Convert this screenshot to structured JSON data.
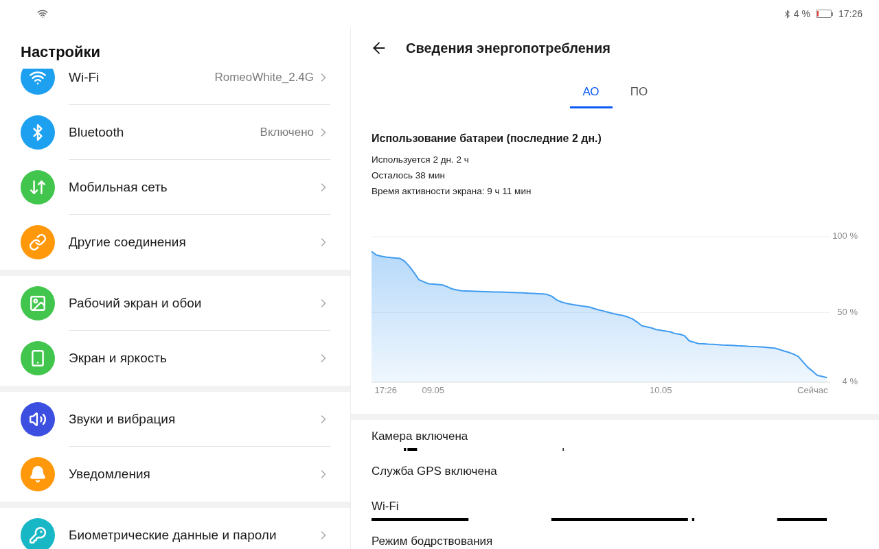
{
  "status_bar": {
    "battery": "4 %",
    "time": "17:26"
  },
  "settings": {
    "title": "Настройки",
    "sections": [
      {
        "items": [
          {
            "label": "Wi-Fi",
            "value": "RomeoWhite_2.4G",
            "color": "#1ea0f0"
          },
          {
            "label": "Bluetooth",
            "value": "Включено",
            "color": "#1ea0f0"
          },
          {
            "label": "Мобильная сеть",
            "color": "#41c54c"
          },
          {
            "label": "Другие соединения",
            "color": "#ff980a"
          }
        ]
      },
      {
        "items": [
          {
            "label": "Рабочий экран и обои",
            "color": "#41c54c"
          },
          {
            "label": "Экран и яркость",
            "color": "#41c54c"
          }
        ]
      },
      {
        "items": [
          {
            "label": "Звуки и вибрация",
            "color": "#3c4fe0"
          },
          {
            "label": "Уведомления",
            "color": "#ff980a"
          }
        ]
      },
      {
        "items": [
          {
            "label": "Биометрические данные и пароли",
            "color": "#17b7c5"
          }
        ]
      }
    ]
  },
  "power_details": {
    "title": "Сведения энергопотребления",
    "tabs": [
      {
        "label": "АО",
        "selected": true
      },
      {
        "label": "ПО",
        "selected": false
      }
    ],
    "usage": {
      "heading": "Использование батареи (последние 2 дн.)",
      "lines": [
        "Используется 2 дн. 2 ч",
        "Осталось 38 мин",
        "Время активности экрана: 9 ч 11 мин"
      ]
    },
    "chart_data": {
      "type": "area",
      "categories": [
        null,
        null,
        null,
        "17:26",
        null,
        null,
        null,
        null,
        null,
        null,
        null,
        null,
        null,
        "09.05",
        null,
        null,
        null,
        null,
        null,
        null,
        null,
        null,
        null,
        null,
        null,
        null,
        null,
        null,
        null,
        null,
        null,
        null,
        null,
        null,
        null,
        null,
        null,
        null,
        null,
        null,
        null,
        null,
        null,
        null,
        null,
        null,
        null,
        null,
        null,
        null,
        null,
        null,
        null,
        null,
        null,
        null,
        null,
        null,
        null,
        null,
        null,
        "10.05",
        null,
        null,
        null,
        null,
        null,
        null,
        null,
        null,
        null,
        null,
        null,
        null,
        null,
        null,
        null,
        null,
        null,
        null,
        null,
        null,
        null,
        null,
        null,
        null,
        null,
        null,
        null,
        null,
        null,
        null,
        null,
        "Сейчас",
        null,
        null,
        null
      ],
      "series": [
        {
          "color": "#3f9bf0",
          "values": [
            90.4,
            88.0,
            87.2,
            86.6,
            86.3,
            86.0,
            85.7,
            83.9,
            80.4,
            76.2,
            71.6,
            70.3,
            69.0,
            68.8,
            68.5,
            68.2,
            67.0,
            65.6,
            64.9,
            64.3,
            64.2,
            64.1,
            64.0,
            63.9,
            63.8,
            63.7,
            63.6,
            63.5,
            63.4,
            63.3,
            63.2,
            63.1,
            63.0,
            62.8,
            62.6,
            62.4,
            62.3,
            61.9,
            60.8,
            58.4,
            57.0,
            56.1,
            55.5,
            55.0,
            54.5,
            54.1,
            53.6,
            52.6,
            51.7,
            50.9,
            50.1,
            49.3,
            48.6,
            48.0,
            47.1,
            45.8,
            43.7,
            41.2,
            40.6,
            39.9,
            38.8,
            38.3,
            37.8,
            37.3,
            36.1,
            35.7,
            34.7,
            31.3,
            30.4,
            29.5,
            29.3,
            29.1,
            29.0,
            28.8,
            28.6,
            28.5,
            28.3,
            28.1,
            28.0,
            27.8,
            27.6,
            27.5,
            27.3,
            27.1,
            26.8,
            26.5,
            25.6,
            24.6,
            23.7,
            22.5,
            20.9,
            17.3,
            13.8,
            11.3,
            8.5,
            7.8,
            7.1
          ]
        }
      ],
      "ylim": [
        4,
        100
      ],
      "yticks": [
        {
          "value": 100,
          "label": "100 %"
        },
        {
          "value": 50,
          "label": "50 %"
        },
        {
          "value": 4,
          "label": "4 %"
        }
      ]
    },
    "activities": [
      {
        "label": "Камера включена"
      },
      {
        "label": "Служба GPS включена"
      },
      {
        "label": "Wi-Fi"
      },
      {
        "label": "Режим бодрствования"
      }
    ]
  }
}
